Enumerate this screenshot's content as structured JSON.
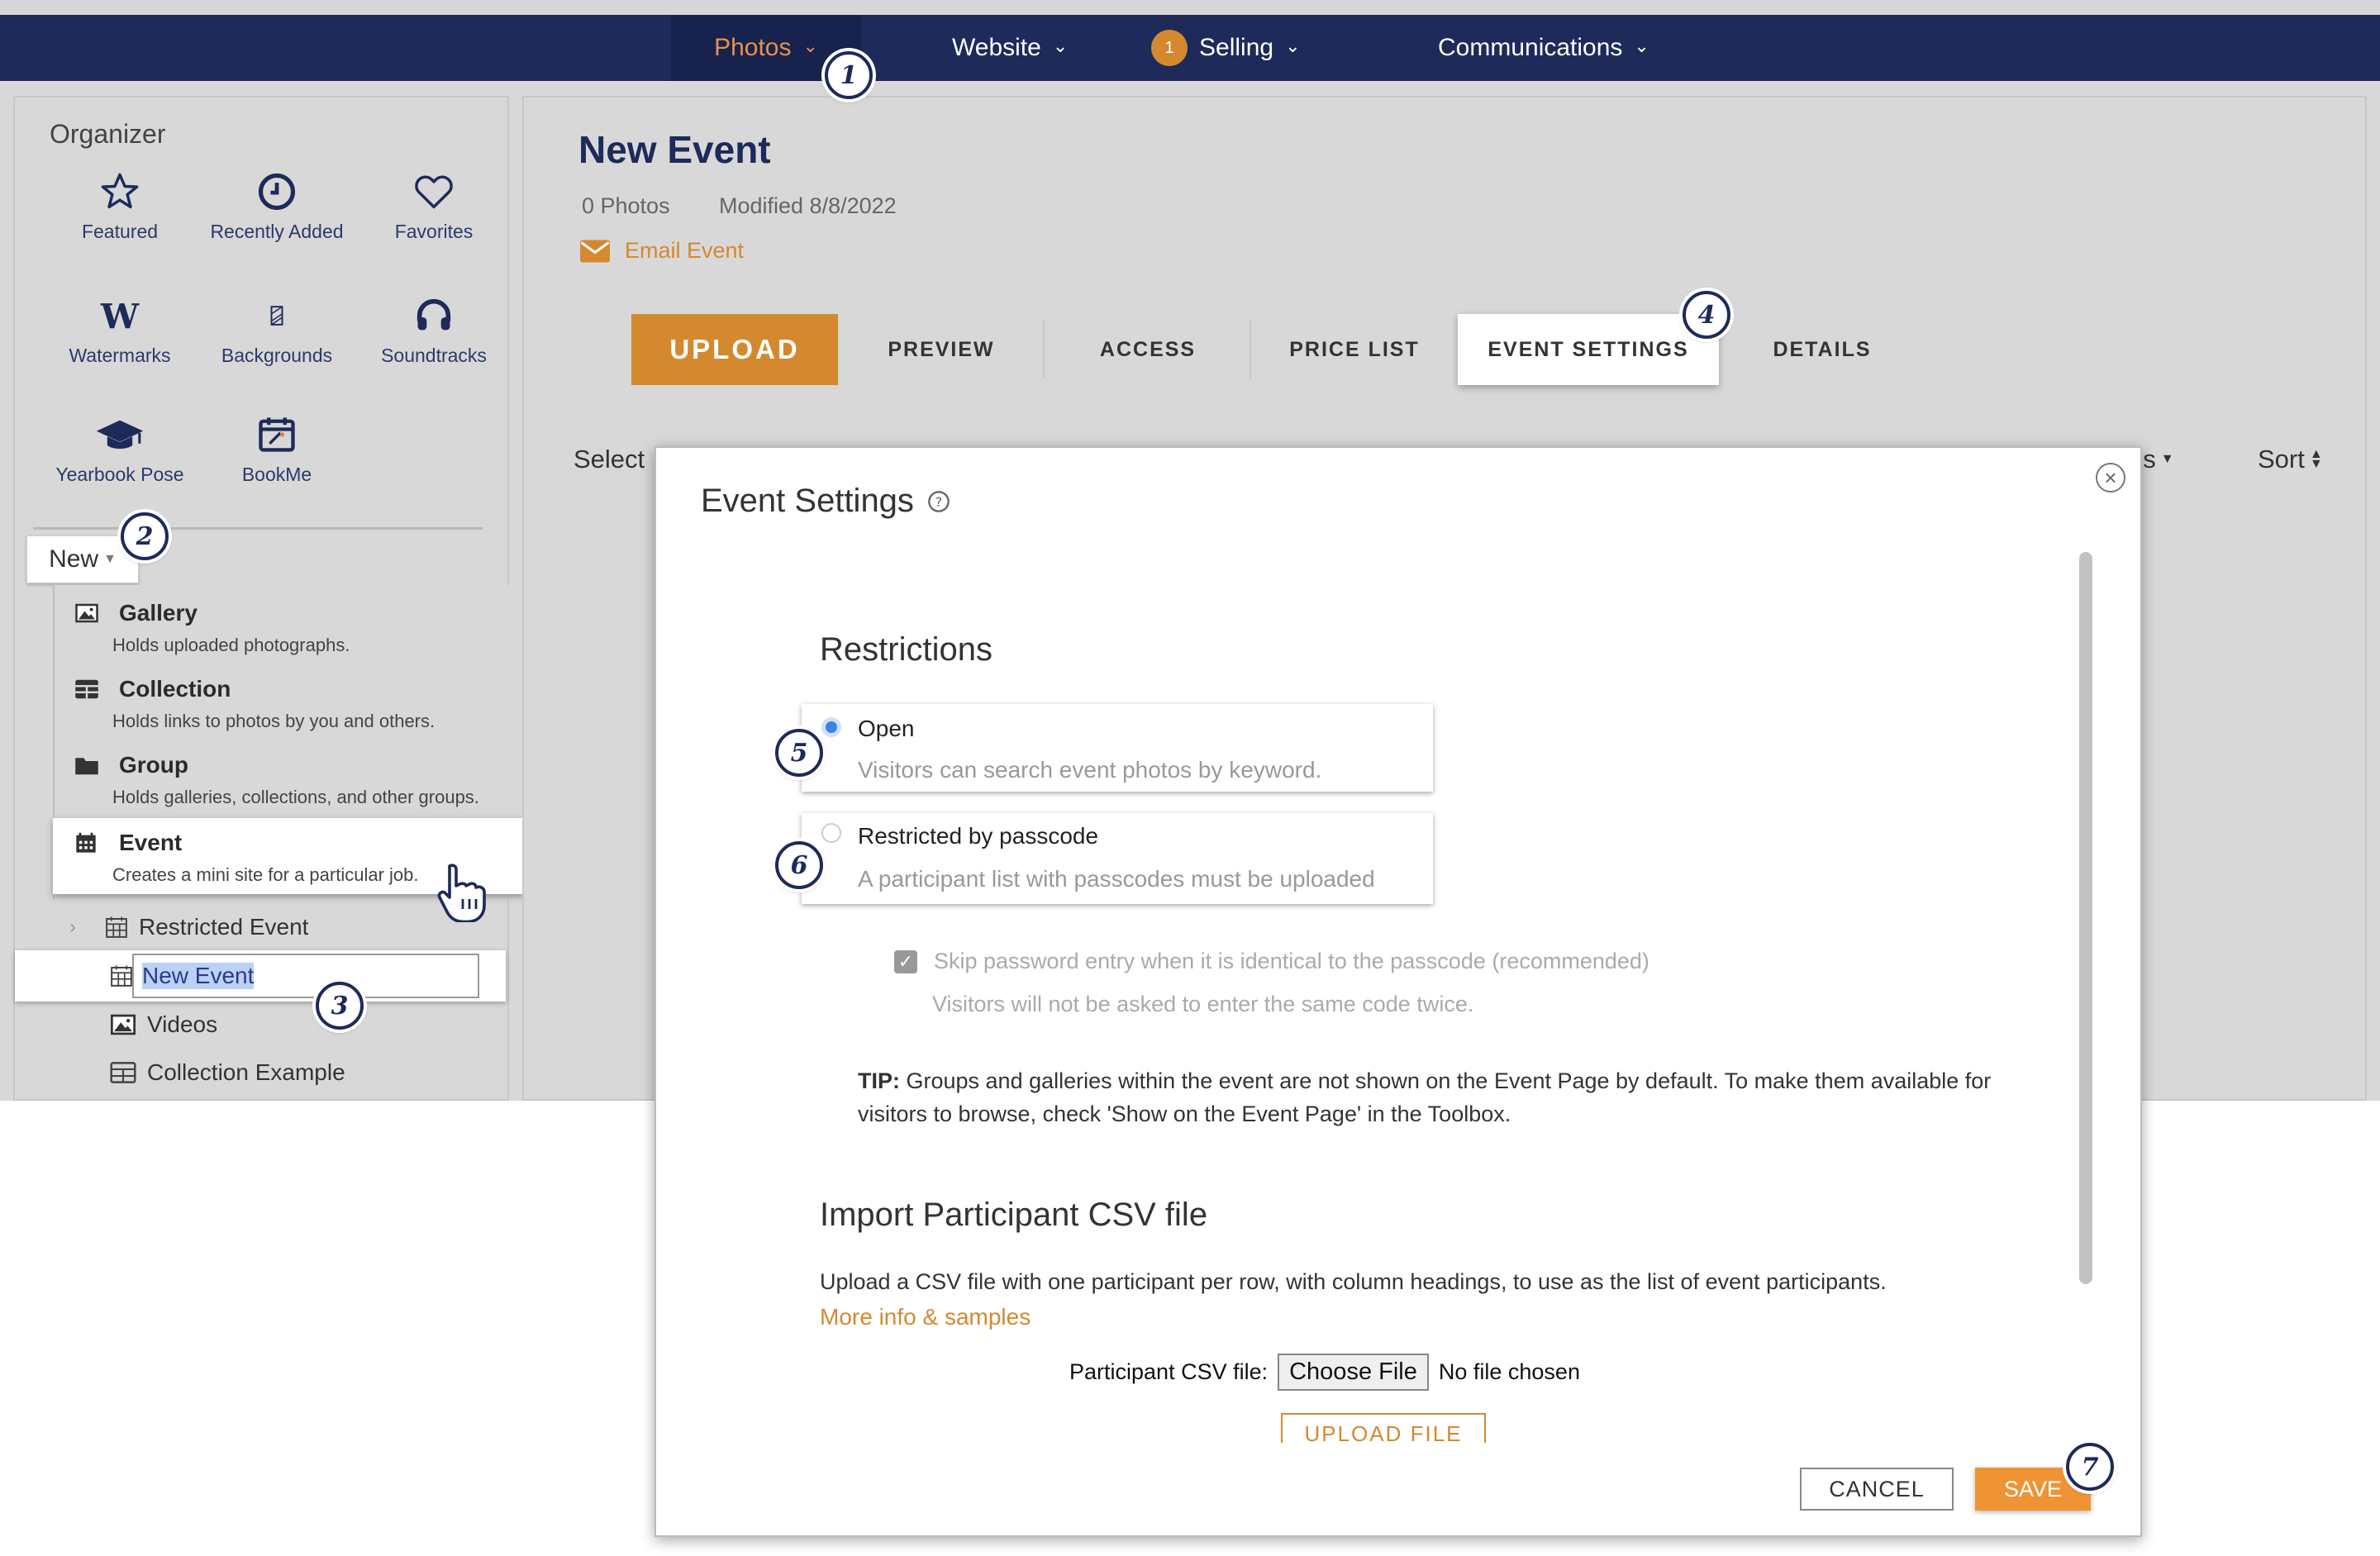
{
  "nav": {
    "photos": "Photos",
    "website": "Website",
    "selling": "Selling",
    "selling_badge": "1",
    "communications": "Communications"
  },
  "sidebar": {
    "title": "Organizer",
    "items": [
      {
        "label": "Featured",
        "icon": "star-icon"
      },
      {
        "label": "Recently Added",
        "icon": "clock-icon"
      },
      {
        "label": "Favorites",
        "icon": "heart-icon"
      },
      {
        "label": "Watermarks",
        "icon": "watermark-icon"
      },
      {
        "label": "Backgrounds",
        "icon": "background-icon"
      },
      {
        "label": "Soundtracks",
        "icon": "headphones-icon"
      },
      {
        "label": "Yearbook Pose",
        "icon": "graduation-cap-icon"
      },
      {
        "label": "BookMe",
        "icon": "calendar-icon"
      }
    ],
    "new_button": "New",
    "new_menu": [
      {
        "title": "Gallery",
        "desc": "Holds uploaded photographs."
      },
      {
        "title": "Collection",
        "desc": "Holds links to photos by you and others."
      },
      {
        "title": "Group",
        "desc": "Holds galleries, collections, and other groups."
      },
      {
        "title": "Event",
        "desc": "Creates a mini site for a particular job."
      }
    ],
    "tree": {
      "restricted_event": "Restricted Event",
      "new_event_input": "New Event",
      "videos": "Videos",
      "collection_example": "Collection Example"
    }
  },
  "main": {
    "title": "New Event",
    "photos_count": "0 Photos",
    "modified": "Modified 8/8/2022",
    "email_event": "Email Event",
    "tabs": {
      "upload": "UPLOAD",
      "preview": "PREVIEW",
      "access": "ACCESS",
      "price_list": "PRICE LIST",
      "event_settings": "EVENT SETTINGS",
      "details": "DETAILS"
    },
    "toolbar": {
      "select": "Select",
      "options_partial": "ns",
      "sort": "Sort"
    }
  },
  "modal": {
    "title": "Event Settings",
    "restrictions_heading": "Restrictions",
    "options": [
      {
        "title": "Open",
        "desc": "Visitors can search event photos by keyword.",
        "selected": true
      },
      {
        "title": "Restricted by passcode",
        "desc": "A participant list with passcodes must be uploaded",
        "selected": false
      }
    ],
    "skip_label": "Skip password entry when it is identical to the passcode (recommended)",
    "skip_desc": "Visitors will not be asked to enter the same code twice.",
    "tip_label": "TIP:",
    "tip_text": " Groups and galleries within the event are not shown on the Event Page by default. To make them available for visitors to browse, check 'Show on the Event Page' in the Toolbox.",
    "import_heading": "Import Participant CSV file",
    "import_desc": "Upload a CSV file with one participant per row, with column headings, to use as the list of event participants.",
    "import_link": "More info & samples",
    "csv_label": "Participant CSV file:",
    "choose_file": "Choose File",
    "no_file": "No file chosen",
    "upload_file": "UPLOAD FILE",
    "cancel": "CANCEL",
    "save": "SAVE"
  },
  "callouts": [
    "1",
    "2",
    "3",
    "4",
    "5",
    "6",
    "7"
  ],
  "colors": {
    "navy": "#1d2a5a",
    "accent_orange": "#d4892f",
    "save_orange": "#ee9434",
    "panel_grey": "#d8d8d8"
  }
}
